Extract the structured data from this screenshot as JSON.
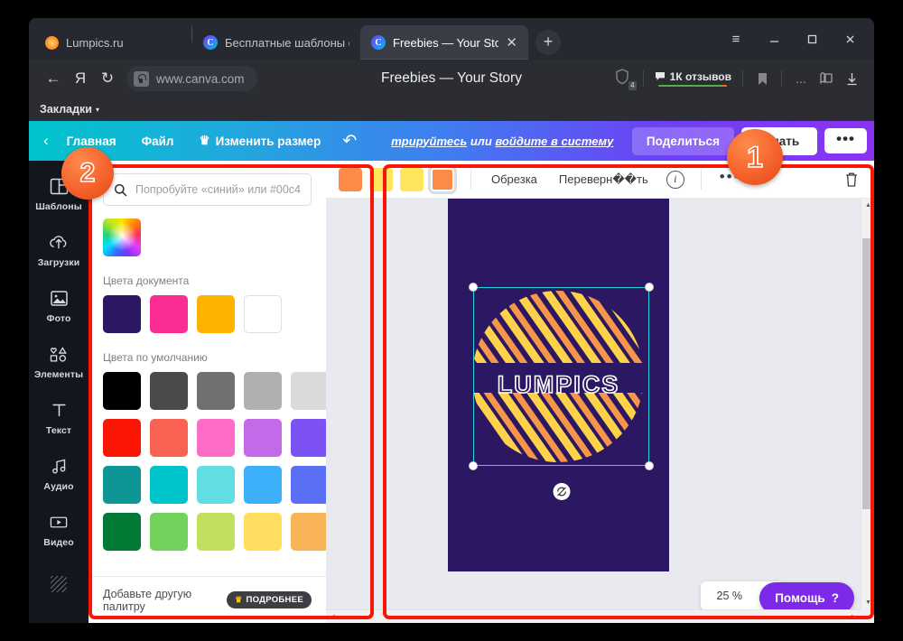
{
  "browser": {
    "tabs": [
      {
        "title": "Lumpics.ru",
        "icon": "orange-favicon",
        "active": false
      },
      {
        "title": "Бесплатные шаблоны стор",
        "icon": "canva-favicon",
        "active": false
      },
      {
        "title": "Freebies — Your Story",
        "icon": "canva-favicon",
        "active": true
      }
    ],
    "new_tab_label": "+",
    "window_controls": {
      "menu": "≡",
      "minimize": "_",
      "maximize": "□",
      "close": "✕"
    },
    "nav": {
      "back_icon": "←",
      "yandex_icon": "Я",
      "reload_icon": "↻",
      "url": "www.canva.com",
      "page_title": "Freebies — Your Story",
      "shield_badge": "4",
      "reviews_label": "1К отзывов",
      "more_icon": "...",
      "collections_icon": "collections-icon",
      "download_icon": "download-icon"
    },
    "bookmarks": {
      "label": "Закладки",
      "caret": "▾"
    }
  },
  "canva": {
    "topbar": {
      "back": "‹",
      "home": "Главная",
      "file": "Файл",
      "resize": "Изменить размер",
      "resize_crown": "♛",
      "undo": "↶",
      "auth_prefix": "трируйтесь",
      "auth_middle": " или ",
      "auth_suffix": "войдите в систему",
      "share": "Поделиться",
      "download": "качать",
      "more": "•••"
    },
    "rail": [
      {
        "label": "Шаблоны",
        "icon": "templates-icon"
      },
      {
        "label": "Загрузки",
        "icon": "uploads-icon"
      },
      {
        "label": "Фото",
        "icon": "photos-icon"
      },
      {
        "label": "Элементы",
        "icon": "elements-icon"
      },
      {
        "label": "Текст",
        "icon": "text-icon"
      },
      {
        "label": "Аудио",
        "icon": "audio-icon"
      },
      {
        "label": "Видео",
        "icon": "video-icon"
      },
      {
        "label": "",
        "icon": "background-icon"
      }
    ],
    "color_panel": {
      "search_placeholder": "Попробуйте «синий» или #00c4cc",
      "search_value": "",
      "rainbow_label": "custom-color-picker",
      "document_colors_title": "Цвета документа",
      "document_colors": [
        "#2c1763",
        "#fa2d92",
        "#ffb300",
        "#ffffff"
      ],
      "default_colors_title": "Цвета по умолчанию",
      "default_colors": [
        [
          "#000000",
          "#4a4a4a",
          "#707070",
          "#b0b0b0",
          "#dadada",
          "#ffffff"
        ],
        [
          "#fa1505",
          "#f96153",
          "#fc6cc8",
          "#c36ae8",
          "#7c52f5",
          "#5a18e8"
        ],
        [
          "#0e9595",
          "#00c4cc",
          "#62dde4",
          "#3cb0fa",
          "#5a6ff5",
          "#0a3f9e"
        ],
        [
          "#017a36",
          "#72d25c",
          "#c2e05e",
          "#ffdd5e",
          "#f9b457",
          "#fb8b46"
        ]
      ],
      "selected_color": "#fb8b46",
      "footer_text": "Добавьте другую палитру",
      "pro_badge": "ПОДРОБНЕЕ"
    },
    "canvas_toolbar": {
      "swatches": [
        "#fb8b46",
        "#ffe55c",
        "#ffe55c",
        "#fb8b46"
      ],
      "selected_swatch_index": 3,
      "crop": "Обрезка",
      "flip": "Переверн��ть",
      "info_icon": "info-icon",
      "more_icon": "•••",
      "trash_icon": "trash-icon"
    },
    "design": {
      "background": "#2c1763",
      "title_text": "LUMPICS",
      "stripe_colors": [
        "#ffd24a",
        "#f79548"
      ],
      "selection_color": "#26d7e8"
    },
    "zoom": {
      "value": "25 %",
      "expand_icon": "expand-icon"
    },
    "help": {
      "label": "Помощь",
      "mark": "?"
    }
  },
  "annotations": {
    "badge_1": "1",
    "badge_2": "2",
    "highlight_color": "#fa1505"
  }
}
